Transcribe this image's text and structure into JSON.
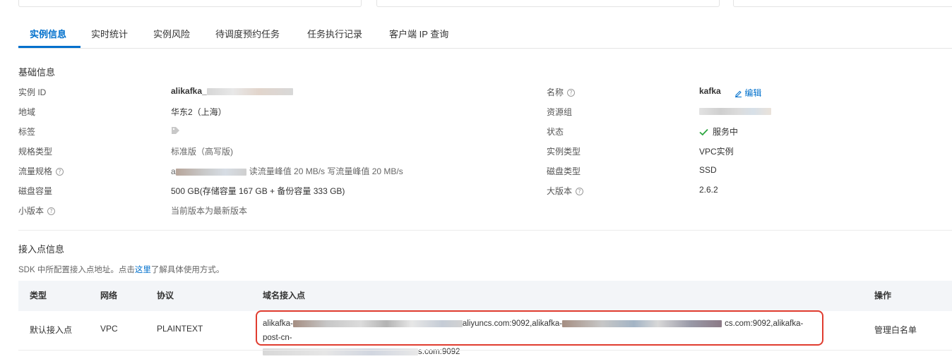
{
  "tabs": [
    "实例信息",
    "实时统计",
    "实例风险",
    "待调度预约任务",
    "任务执行记录",
    "客户端 IP 查询"
  ],
  "basic_section_title": "基础信息",
  "left_fields": [
    {
      "label": "实例 ID",
      "value": "alikafka_"
    },
    {
      "label": "地域",
      "value": "华东2（上海）"
    },
    {
      "label": "标签",
      "value": ""
    },
    {
      "label": "规格类型",
      "value": "标准版（高写版)"
    },
    {
      "label": "流量规格",
      "value": "读流量峰值 20 MB/s 写流量峰值 20 MB/s"
    },
    {
      "label": "磁盘容量",
      "value": "500 GB(存储容量 167 GB + 备份容量 333 GB)"
    },
    {
      "label": "小版本",
      "value": "当前版本为最新版本"
    }
  ],
  "flow_prefix": "a",
  "right_fields": [
    {
      "label": "名称",
      "value": "kafka"
    },
    {
      "label": "资源组",
      "value": ""
    },
    {
      "label": "状态",
      "value": "服务中"
    },
    {
      "label": "实例类型",
      "value": "VPC实例"
    },
    {
      "label": "磁盘类型",
      "value": "SSD"
    },
    {
      "label": "大版本",
      "value": "2.6.2"
    }
  ],
  "edit_label": "编辑",
  "help_glyph": "?",
  "endpoint_section": {
    "title": "接入点信息",
    "desc_before": "SDK 中所配置接入点地址。点击",
    "desc_link": "这里",
    "desc_after": "了解具体使用方式。"
  },
  "table": {
    "headers": [
      "类型",
      "网络",
      "协议",
      "域名接入点",
      "操作"
    ],
    "row": {
      "type": "默认接入点",
      "network": "VPC",
      "protocol": "PLAINTEXT",
      "ep_part1": "alikafka-",
      "ep_part2": "aliyuncs.com:9092,alikafka-",
      "ep_part3": "cs.com:9092,alikafka-post-cn-",
      "ep_part4": "s.com:9092",
      "action": "管理白名单"
    }
  },
  "colors": {
    "accent": "#0070cc",
    "success": "#2da641",
    "highlight_box": "#e03c2f"
  }
}
